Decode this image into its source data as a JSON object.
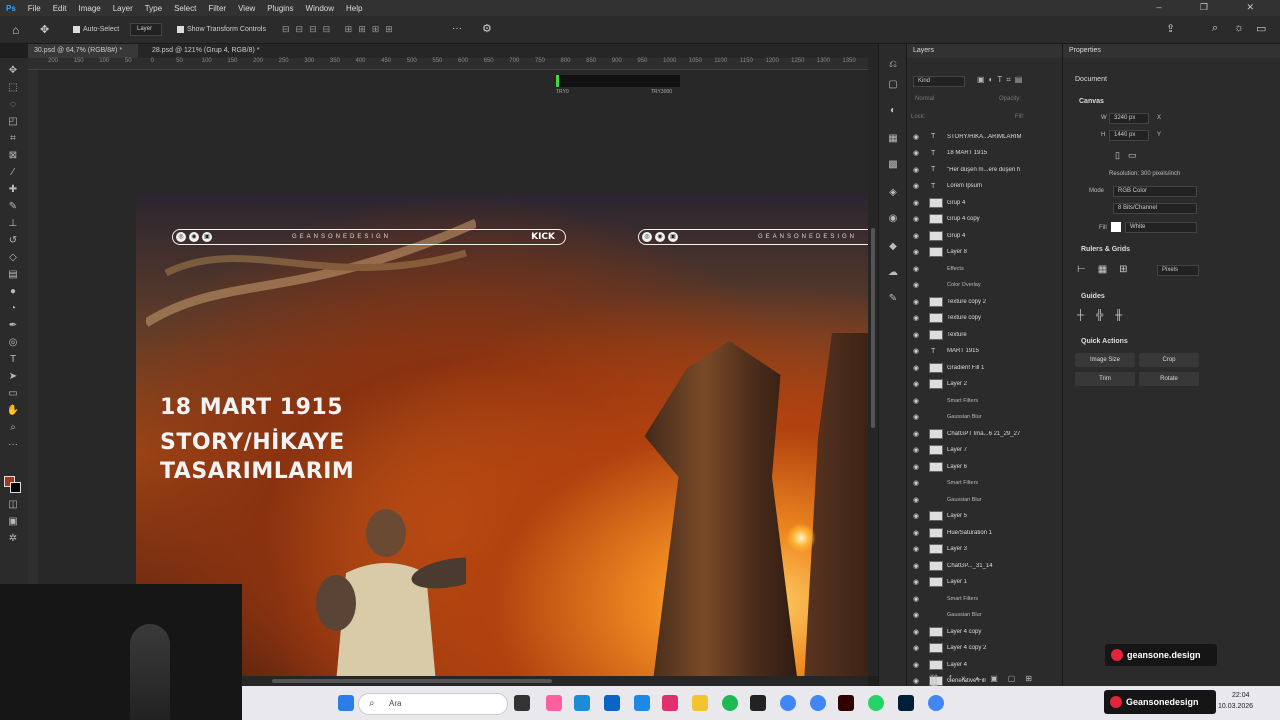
{
  "menu": [
    "File",
    "Edit",
    "Image",
    "Layer",
    "Type",
    "Select",
    "Filter",
    "View",
    "Plugins",
    "Window",
    "Help"
  ],
  "options": {
    "auto_select": "Auto-Select",
    "layer_dropdown": "Layer",
    "show_transform": "Show Transform Controls"
  },
  "tabs": [
    "30.psd @ 64,7% (RGB/8#) *",
    "28.psd @ 121% (Grup 4, RGB/8) *"
  ],
  "ruler": [
    "200",
    "150",
    "100",
    "50",
    "0",
    "50",
    "100",
    "150",
    "200",
    "250",
    "300",
    "350",
    "400",
    "450",
    "500",
    "550",
    "600",
    "650",
    "700",
    "750",
    "800",
    "850",
    "900",
    "950",
    "1000",
    "1050",
    "1100",
    "1150",
    "1200",
    "1250",
    "1300",
    "1350"
  ],
  "progress": {
    "left": "TRY0",
    "right": "TRY3000"
  },
  "design": {
    "brand": "GEANSONEDESIGN",
    "kick": "KICK",
    "line1": "18 MART 1915",
    "line2": "STORY/HİKAYE",
    "line3": "TASARIMLARIM"
  },
  "layers_panel": {
    "title": "Layers",
    "kind": "Kind",
    "blend": "Normal",
    "opacity": "Opacity:",
    "fill": "Fill:",
    "lock": "Lock:",
    "rows": [
      {
        "name": "STORY/HİKA...ARIMLARIM",
        "type": "T"
      },
      {
        "name": "18 MART 1915",
        "type": "T"
      },
      {
        "name": "\"Her düşen m...ere düşen h",
        "type": "T"
      },
      {
        "name": "Lorem Ipsum",
        "type": "T"
      },
      {
        "name": "Grup 4",
        "type": "F"
      },
      {
        "name": "Grup 4 copy",
        "type": "F"
      },
      {
        "name": "Grup 4",
        "type": "F"
      },
      {
        "name": "Layer 8",
        "type": "L"
      },
      {
        "name": "Effects",
        "type": "S"
      },
      {
        "name": "Color Overlay",
        "type": "S"
      },
      {
        "name": "Texture copy 2",
        "type": "L"
      },
      {
        "name": "Texture copy",
        "type": "L"
      },
      {
        "name": "Texture",
        "type": "L"
      },
      {
        "name": "MART 1915",
        "type": "T"
      },
      {
        "name": "Gradient Fill 1",
        "type": "L"
      },
      {
        "name": "Layer 2",
        "type": "L"
      },
      {
        "name": "Smart Filters",
        "type": "S"
      },
      {
        "name": "Gaussian Blur",
        "type": "S"
      },
      {
        "name": "ChatGPT Ima...6 21_29_27",
        "type": "L"
      },
      {
        "name": "Layer 7",
        "type": "L"
      },
      {
        "name": "Layer 6",
        "type": "L"
      },
      {
        "name": "Smart Filters",
        "type": "S"
      },
      {
        "name": "Gaussian Blur",
        "type": "S"
      },
      {
        "name": "Layer 5",
        "type": "L"
      },
      {
        "name": "Hue/Saturation 1",
        "type": "L"
      },
      {
        "name": "Layer 3",
        "type": "L"
      },
      {
        "name": "ChatGP..._31_14",
        "type": "L"
      },
      {
        "name": "Layer 1",
        "type": "L"
      },
      {
        "name": "Smart Filters",
        "type": "S"
      },
      {
        "name": "Gaussian Blur",
        "type": "S"
      },
      {
        "name": "Layer 4 copy",
        "type": "L"
      },
      {
        "name": "Layer 4 copy 2",
        "type": "L"
      },
      {
        "name": "Layer 4",
        "type": "L"
      },
      {
        "name": "Generative Fill",
        "type": "L"
      }
    ]
  },
  "properties": {
    "title": "Properties",
    "doc": "Document",
    "canvas": "Canvas",
    "w_label": "W",
    "w": "3240 px",
    "x": "X",
    "h_label": "H",
    "h": "1440 px",
    "y": "Y",
    "resolution": "Resolution: 300 pixels/inch",
    "mode_label": "Mode",
    "mode": "RGB Color",
    "bits": "8 Bits/Channel",
    "fill_label": "Fill",
    "fill": "White",
    "rulers": "Rulers & Grids",
    "units": "Pixels",
    "guides": "Guides",
    "quick": "Quick Actions",
    "image_size": "Image Size",
    "crop": "Crop",
    "trim": "Trim",
    "rotate": "Rotate"
  },
  "badge1": "geansone.design",
  "badge2": "Geansonedesign",
  "taskbar": {
    "search": "Ara",
    "time": "22:04",
    "date": "10.03.2026"
  }
}
